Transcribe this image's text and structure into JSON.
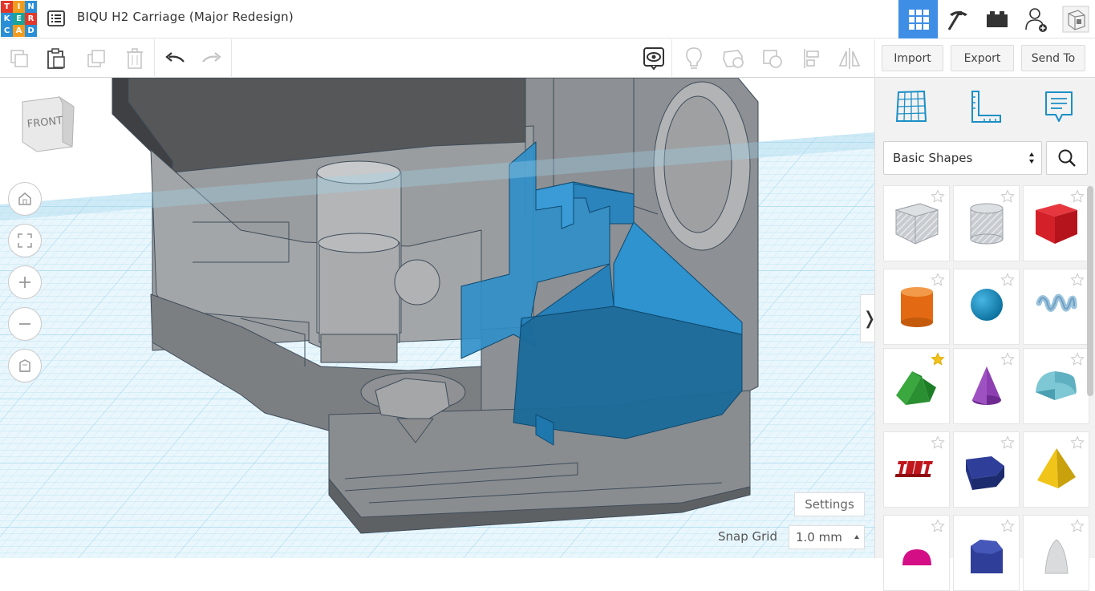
{
  "logo": {
    "letters": [
      "T",
      "I",
      "N",
      "K",
      "E",
      "R",
      "C",
      "A",
      "D"
    ]
  },
  "header": {
    "title": "BIQU H2 Carriage (Major Redesign)"
  },
  "top_right_buttons": [
    "3d-design-view-icon",
    "codeblocks-pickaxe-icon",
    "bricks-icon",
    "user-add-icon",
    "avatar"
  ],
  "toolbar": {
    "left_tools": [
      "copy-icon",
      "paste-icon",
      "duplicate-icon",
      "delete-icon",
      "undo-icon",
      "redo-icon"
    ],
    "right_tools": [
      "notes-visibility-icon",
      "light-bulb-icon",
      "shape-hole-icon",
      "group-icon",
      "align-icon",
      "mirror-icon"
    ],
    "import_label": "Import",
    "export_label": "Export",
    "send_to_label": "Send To"
  },
  "workplane": {
    "viewcube_label": "FRONT",
    "nav_buttons": [
      "home-view-icon",
      "fit-view-icon",
      "zoom-in-icon",
      "zoom-out-icon",
      "perspective-icon"
    ],
    "settings_label": "Settings",
    "snap_grid_label": "Snap Grid",
    "snap_grid_value": "1.0 mm",
    "collapse_glyph": "❭"
  },
  "panel": {
    "icons": [
      "workplane-grid-icon",
      "ruler-icon",
      "notes-icon"
    ],
    "category": "Basic Shapes",
    "shapes": [
      {
        "name": "box-hole",
        "favorite": false
      },
      {
        "name": "cylinder-hole",
        "favorite": false
      },
      {
        "name": "box",
        "favorite": false
      },
      {
        "name": "cylinder",
        "favorite": false
      },
      {
        "name": "sphere",
        "favorite": false
      },
      {
        "name": "scribble",
        "favorite": false
      },
      {
        "name": "roof",
        "favorite": true
      },
      {
        "name": "cone",
        "favorite": false
      },
      {
        "name": "round-roof",
        "favorite": false
      },
      {
        "name": "text",
        "favorite": false
      },
      {
        "name": "polygon",
        "favorite": false
      },
      {
        "name": "pyramid",
        "favorite": false
      },
      {
        "name": "half-sphere",
        "favorite": false
      },
      {
        "name": "hexagonal-prism",
        "favorite": false
      },
      {
        "name": "paraboloid",
        "favorite": false
      }
    ]
  },
  "colors": {
    "accent": "#3f8ee6",
    "shape_blue": "#1a7fba",
    "grid": "#b8e2f2"
  }
}
